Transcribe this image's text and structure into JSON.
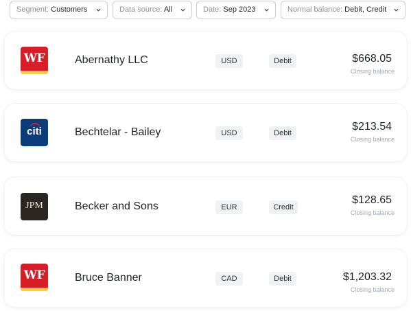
{
  "filters": [
    {
      "label": "Segment:",
      "value": "Customers"
    },
    {
      "label": "Data source:",
      "value": "All"
    },
    {
      "label": "Date:",
      "value": "Sep 2023"
    },
    {
      "label": "Normal balance:",
      "value": "Debit, Credit"
    }
  ],
  "accounts": [
    {
      "logo": "wells-fargo-logo",
      "logo_text": "WF",
      "name": "Abernathy LLC",
      "currency": "USD",
      "balance_type": "Debit",
      "amount": "$668.05",
      "amount_caption": "Closing balance"
    },
    {
      "logo": "citi-logo",
      "logo_text": "citi",
      "name": "Bechtelar - Bailey",
      "currency": "USD",
      "balance_type": "Debit",
      "amount": "$213.54",
      "amount_caption": "Closing balance"
    },
    {
      "logo": "jpm-logo",
      "logo_text": "JPM",
      "name": "Becker and Sons",
      "currency": "EUR",
      "balance_type": "Credit",
      "amount": "$128.65",
      "amount_caption": "Closing balance"
    },
    {
      "logo": "wells-fargo-logo",
      "logo_text": "WF",
      "name": "Bruce Banner",
      "currency": "CAD",
      "balance_type": "Debit",
      "amount": "$1,203.32",
      "amount_caption": "Closing balance"
    }
  ],
  "colors": {
    "wells_fargo_red": "#d71e28",
    "wells_fargo_gold": "#ffcd41",
    "citi_blue": "#0b3d7a",
    "citi_red": "#e4202e",
    "jpm_dark": "#2b2622",
    "pill_bg": "#f0f1f3"
  }
}
